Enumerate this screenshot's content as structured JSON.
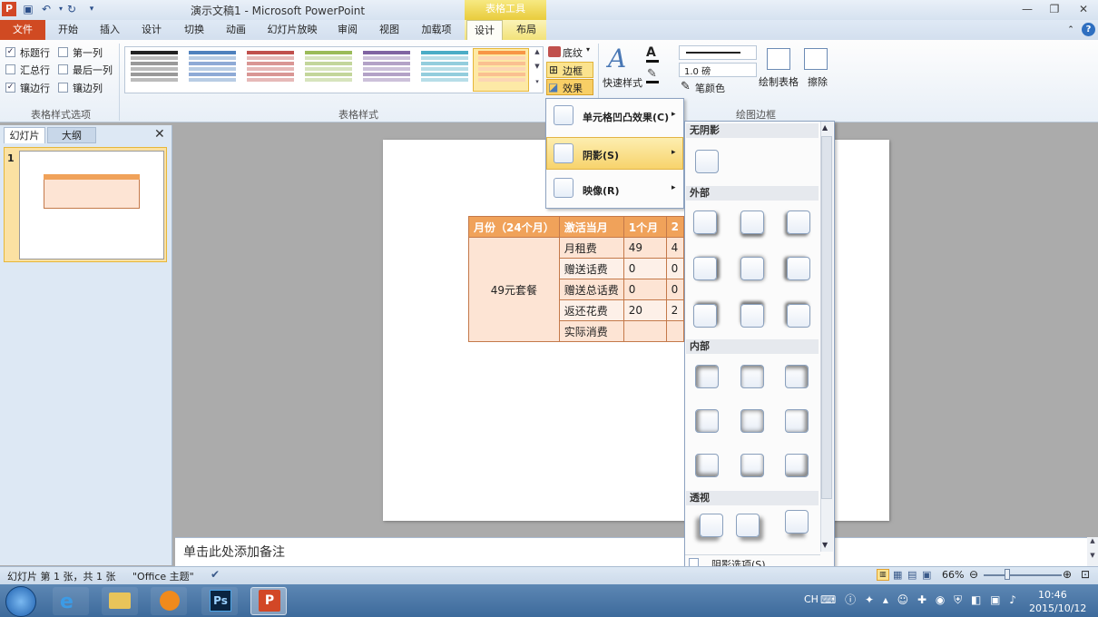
{
  "window": {
    "title": "演示文稿1 - Microsoft PowerPoint",
    "context_tag": "表格工具"
  },
  "tabs": [
    "文件",
    "开始",
    "插入",
    "设计",
    "切换",
    "动画",
    "幻灯片放映",
    "审阅",
    "视图",
    "加载项",
    "设计",
    "布局"
  ],
  "ribbon": {
    "options": {
      "header_row": "标题行",
      "first_col": "第一列",
      "total_row": "汇总行",
      "last_col": "最后一列",
      "banded_rows": "镶边行",
      "banded_cols": "镶边列",
      "group_label": "表格样式选项"
    },
    "styles": {
      "group_label": "表格样式",
      "shading": "底纹",
      "borders": "边框",
      "effects": "效果"
    },
    "quick": {
      "label": "快速样式"
    },
    "draw": {
      "pen_weight": "1.0 磅",
      "pen_color": "笔颜色",
      "draw_table": "绘制表格",
      "eraser": "擦除",
      "group_label": "绘图边框"
    }
  },
  "thumbs": {
    "tab_slides": "幻灯片",
    "tab_outline": "大纲",
    "slide_num": "1"
  },
  "table": {
    "headers": [
      "月份（24个月）",
      "激活当月",
      "1个月",
      "2"
    ],
    "package": "49元套餐",
    "rows": [
      [
        "月租费",
        "49",
        "4"
      ],
      [
        "赠送话费",
        "0",
        "0"
      ],
      [
        "赠送总话费",
        "0",
        "0"
      ],
      [
        "返还花费",
        "20",
        "2"
      ],
      [
        "实际消费",
        "",
        ""
      ]
    ]
  },
  "effects_menu": {
    "bevel": "单元格凹凸效果(C)",
    "shadow": "阴影(S)",
    "reflection": "映像(R)"
  },
  "shadow_menu": {
    "none": "无阴影",
    "outer": "外部",
    "inner": "内部",
    "perspective": "透视",
    "options": "阴影选项(S)..."
  },
  "notes": {
    "placeholder": "单击此处添加备注"
  },
  "status": {
    "slide_info": "幻灯片 第 1 张，共 1 张",
    "theme": "\"Office 主题\"",
    "zoom": "66%"
  },
  "taskbar": {
    "lang": "CH",
    "time": "10:46",
    "date": "2015/10/12"
  }
}
